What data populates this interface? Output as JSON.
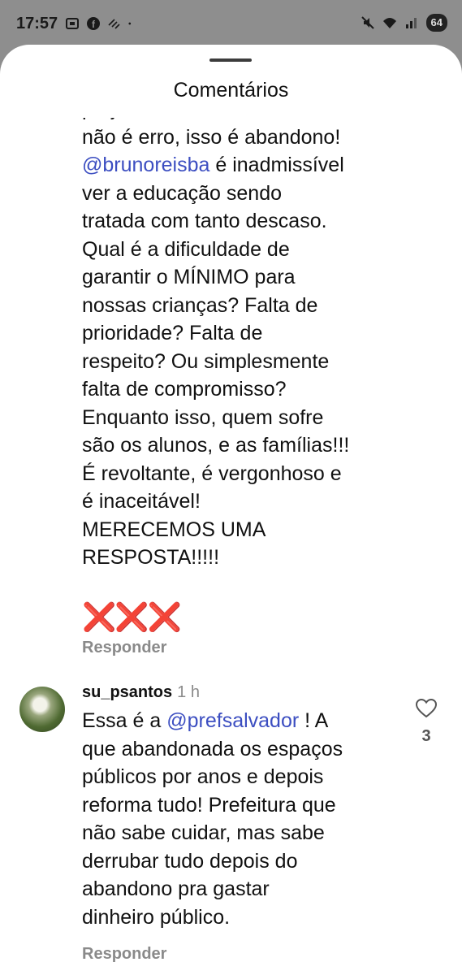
{
  "status_bar": {
    "time": "17:57",
    "battery": "64"
  },
  "header": {
    "title": "Comentários"
  },
  "comment1": {
    "line_before": "projeto Pé na Escola. Isso\nnão é erro, isso é abandono!",
    "mention": "@brunoreisba",
    "line_after": " é inadmissível\nver a educação sendo\ntratada com tanto descaso.\nQual é a dificuldade de\ngarantir o MÍNIMO para\nnossas crianças? Falta de\nprioridade? Falta de\nrespeito? Ou simplesmente\nfalta de compromisso?\nEnquanto isso, quem sofre\nsão os alunos, e as famílias!!!\nÉ revoltante, é vergonhoso e\né inaceitável!\nMERECEMOS UMA\nRESPOSTA!!!!!",
    "emojis": "❌❌❌",
    "reply_label": "Responder"
  },
  "comment2": {
    "username": "su_psantos",
    "time": "1 h",
    "text_before": "Essa é a ",
    "mention": "@prefsalvador",
    "text_after": " ! A\nque abandonada os espaços\npúblicos por anos e depois\nreforma tudo! Prefeitura que\nnão sabe cuidar, mas sabe\nderrubar tudo depois do\nabandono pra gastar\ndinheiro público.",
    "like_count": "3",
    "reply_label": "Responder"
  },
  "colors": {
    "mention": "#3c4ec1",
    "secondary_text": "#8a8a8a",
    "emoji_red": "#e8264a"
  },
  "icons": [
    "heart-icon",
    "wifi-icon",
    "mute-icon",
    "signal-icon",
    "facebook-icon",
    "screenshot-icon"
  ]
}
